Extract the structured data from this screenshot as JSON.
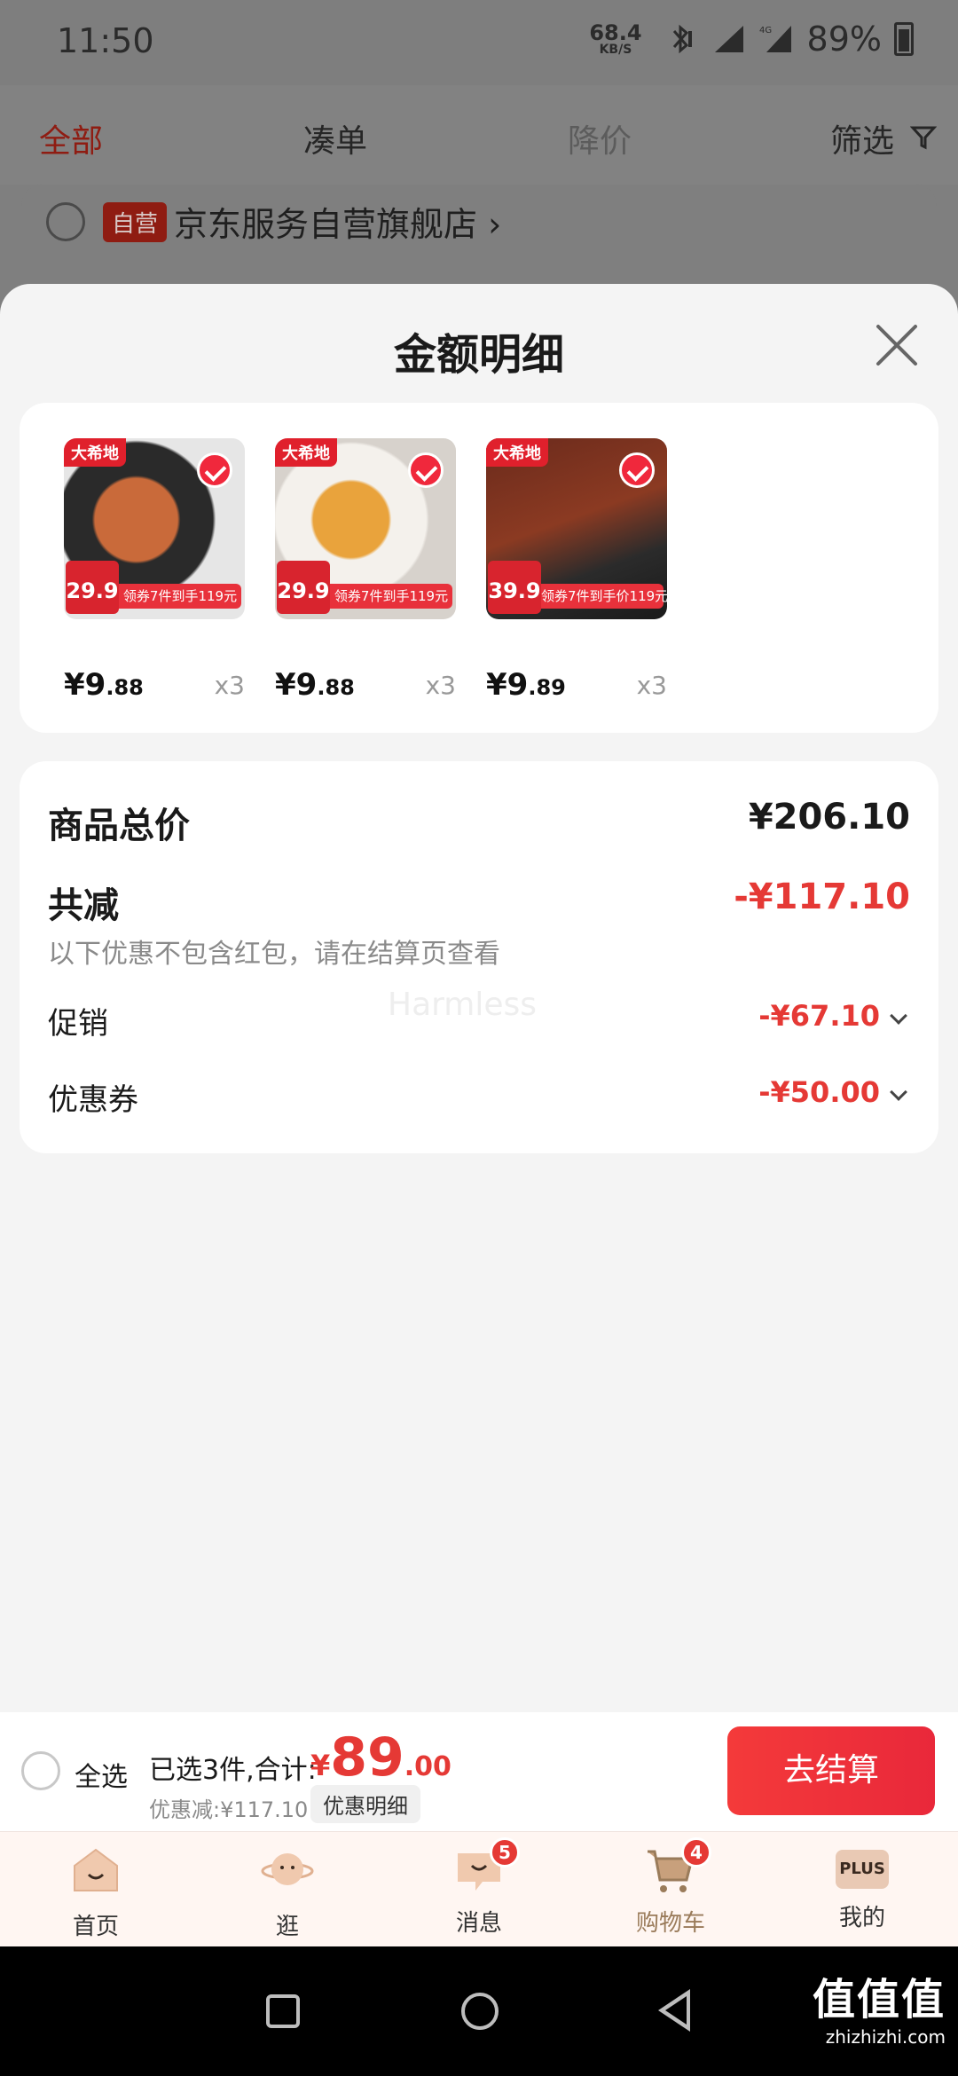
{
  "status_bar": {
    "time": "11:50",
    "net_speed": "68.4",
    "net_unit": "KB/S",
    "network": "4G",
    "battery": "89%"
  },
  "bg_page": {
    "tabs": [
      "全部",
      "凑单",
      "降价",
      "筛选"
    ],
    "store_badge": "自营",
    "store_name": "京东服务自营旗舰店 ›"
  },
  "sheet": {
    "title": "金额明细",
    "products": [
      {
        "brand": "大希地",
        "promo_price": "29.9",
        "promo_text": "领券7件到手119元",
        "price_int": "¥9",
        "price_dec": ".88",
        "qty": "x3",
        "image": "sausage-photo"
      },
      {
        "brand": "大希地",
        "promo_price": "29.9",
        "promo_text": "领券7件到手119元",
        "price_int": "¥9",
        "price_dec": ".88",
        "qty": "x3",
        "image": "chicken-cutlet-photo"
      },
      {
        "brand": "大希地",
        "promo_price": "39.9",
        "promo_text": "领券7件到手价119元",
        "price_int": "¥9",
        "price_dec": ".89",
        "qty": "x3",
        "image": "lamb-skewer-photo"
      }
    ],
    "summary": {
      "total_label": "商品总价",
      "total_value": "¥206.10",
      "reduce_label": "共减",
      "reduce_value": "-¥117.10",
      "note": "以下优惠不包含红包，请在结算页查看",
      "promo_label": "促销",
      "promo_value": "-¥67.10",
      "coupon_label": "优惠券",
      "coupon_value": "-¥50.00",
      "watermark": "Harmless"
    }
  },
  "checkout": {
    "select_all": "全选",
    "selected_text": "已选3件,合计:",
    "currency": "¥",
    "total_int": "89",
    "total_dec": ".00",
    "discount_text": "优惠减:¥117.10",
    "detail_btn": "优惠明细",
    "submit": "去结算"
  },
  "tabbar": {
    "items": [
      {
        "label": "首页",
        "icon": "home-icon"
      },
      {
        "label": "逛",
        "icon": "planet-icon"
      },
      {
        "label": "消息",
        "icon": "message-icon",
        "badge": "5"
      },
      {
        "label": "购物车",
        "icon": "cart-icon",
        "badge": "4"
      },
      {
        "label": "我的",
        "icon": "plus-member-icon",
        "icon_text": "PLUS"
      }
    ]
  },
  "watermark": {
    "text": "值值值",
    "domain": "zhizhizhi.com"
  },
  "colors": {
    "accent_red": "#e53935",
    "cart_active": "#9a7b5a"
  }
}
